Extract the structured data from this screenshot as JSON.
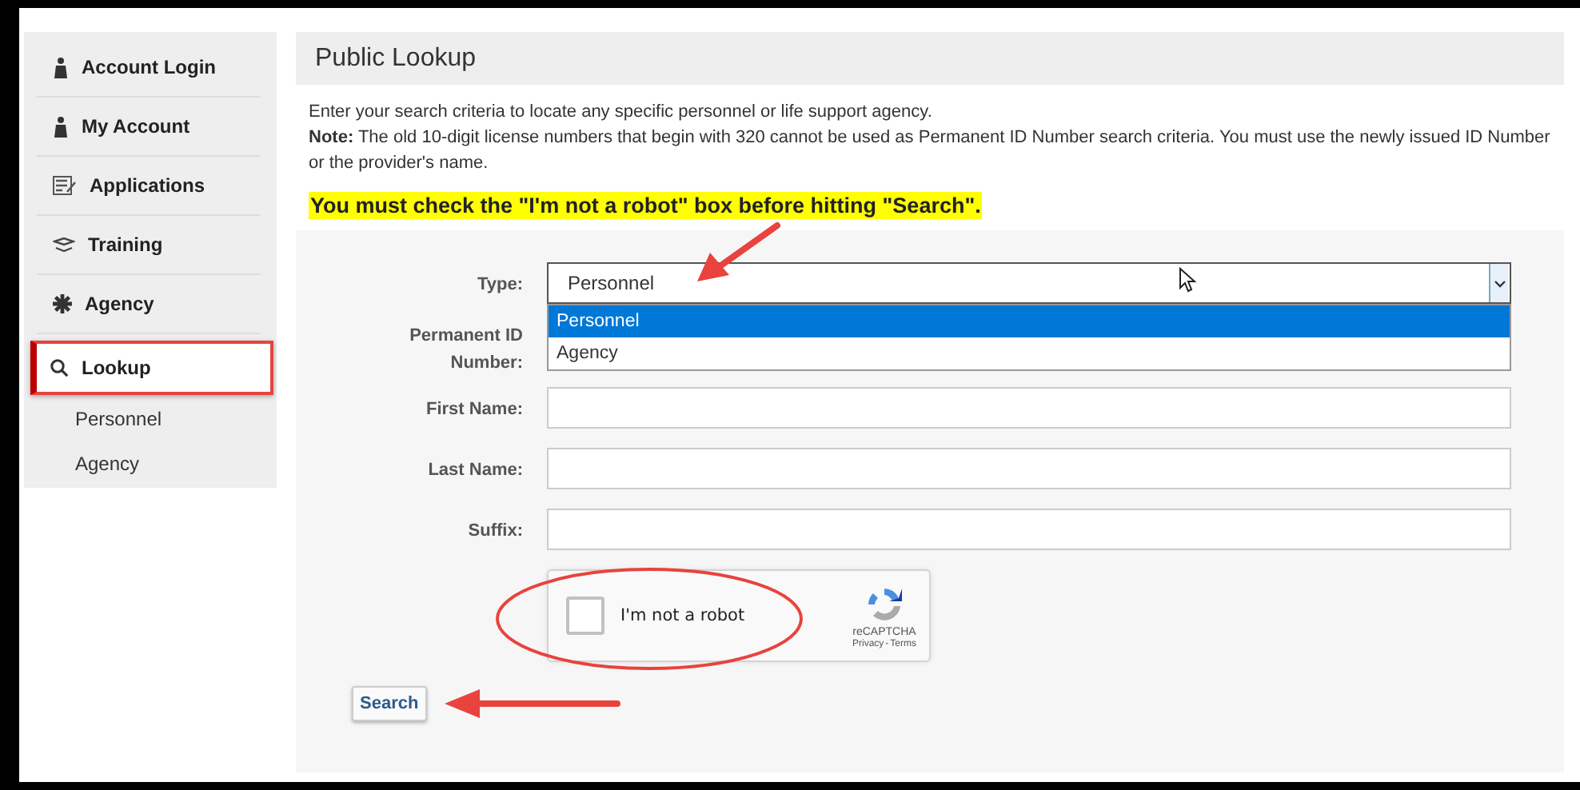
{
  "sidebar": {
    "items": [
      {
        "label": "Account Login",
        "kind": "person",
        "selected": false
      },
      {
        "label": "My Account",
        "kind": "person",
        "selected": false
      },
      {
        "label": "Applications",
        "kind": "form",
        "selected": false
      },
      {
        "label": "Training",
        "kind": "cap",
        "selected": false
      },
      {
        "label": "Agency",
        "kind": "gear",
        "selected": false
      },
      {
        "label": "Lookup",
        "kind": "search",
        "selected": true,
        "children": [
          {
            "label": "Personnel"
          },
          {
            "label": "Agency"
          }
        ]
      }
    ]
  },
  "page": {
    "title": "Public Lookup",
    "intro": "Enter your search criteria to locate any specific personnel or life support agency.",
    "note": "**Note:** The old 10-digit license numbers that begin with 320 cannot be used as Permanent ID Number search criteria. You must use the newly issued ID Number or the provider's name.",
    "warning": "You must check the \"I'm not a robot\" box before hitting \"Search\"."
  },
  "form": {
    "type": {
      "label": "Type:",
      "value": "Personnel",
      "expanded": true,
      "options": [
        {
          "label": "Personnel",
          "selected": true
        },
        {
          "label": "Agency",
          "selected": false
        }
      ]
    },
    "fields": [
      {
        "label": "Permanent ID Number:"
      },
      {
        "label": "First Name:"
      },
      {
        "label": "Last Name:"
      },
      {
        "label": "Suffix:"
      }
    ],
    "captcha": {
      "label": "I'm not a robot",
      "checked": false,
      "brand": "reCAPTCHA",
      "privacy": "Privacy",
      "separator": "-",
      "terms": "Terms"
    },
    "submit": "Search"
  }
}
